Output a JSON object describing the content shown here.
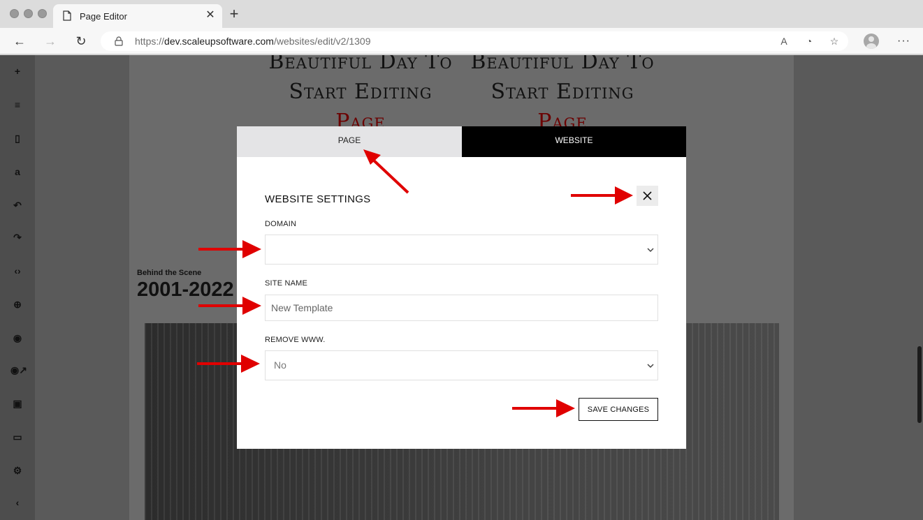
{
  "browser": {
    "tab_title": "Page Editor",
    "url_prefix": "https://",
    "url_host": "dev.scaleupsoftware.com",
    "url_path": "/websites/edit/v2/1309"
  },
  "page": {
    "hero_left": {
      "line1": "Beautiful Day To",
      "line2": "Start Editing",
      "accent": "Page"
    },
    "hero_right": {
      "line1": "Beautiful Day To",
      "line2": "Start Editing",
      "accent": "Page"
    },
    "scene_label": "Behind the Scene",
    "scene_years": "2001-2022"
  },
  "modal": {
    "tabs": [
      {
        "label": "PAGE",
        "active": true
      },
      {
        "label": "WEBSITE",
        "active": false
      }
    ],
    "heading": "WEBSITE SETTINGS",
    "fields": {
      "domain": {
        "label": "DOMAIN",
        "value": ""
      },
      "site_name": {
        "label": "SITE NAME",
        "value": "",
        "placeholder": "New Template"
      },
      "remove_www": {
        "label": "REMOVE WWW.",
        "value": "No"
      }
    },
    "save_label": "SAVE CHANGES"
  },
  "colors": {
    "accent_red": "#e00000",
    "hero_accent": "#6b0000",
    "tab_active_bg": "#e4e4e6",
    "tab_inactive_bg": "#000000"
  }
}
